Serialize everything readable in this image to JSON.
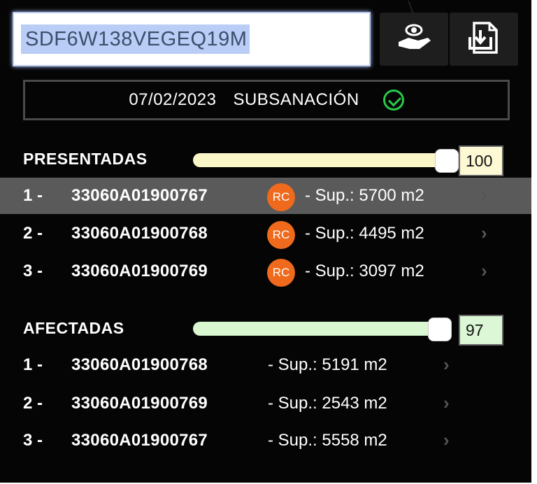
{
  "search": {
    "value": "SDF6W138VEGEQ19M"
  },
  "toolbar": {
    "hand_icon": "hand-pointer-icon",
    "export_icon": "document-download-icon"
  },
  "status": {
    "date": "07/02/2023",
    "label": "SUBSANACIÓN",
    "icon": "check-circle-icon",
    "color": "#28c94a"
  },
  "presentadas": {
    "title": "PRESENTADAS",
    "slider_value": "100",
    "track_color": "#fbf6c8",
    "items": [
      {
        "index": "1 -",
        "code": "33060A01900767",
        "badge": "RC",
        "sup": "- Sup.: 5700 m2"
      },
      {
        "index": "2 -",
        "code": "33060A01900768",
        "badge": "RC",
        "sup": "- Sup.: 4495 m2"
      },
      {
        "index": "3 -",
        "code": "33060A01900769",
        "badge": "RC",
        "sup": "- Sup.: 3097 m2"
      }
    ]
  },
  "afectadas": {
    "title": "AFECTADAS",
    "slider_value": "97",
    "track_color": "#d9f7d0",
    "items": [
      {
        "index": "1 -",
        "code": "33060A01900768",
        "sup": "- Sup.: 5191 m2"
      },
      {
        "index": "2 -",
        "code": "33060A01900769",
        "sup": "- Sup.: 2543 m2"
      },
      {
        "index": "3 -",
        "code": "33060A01900767",
        "sup": "- Sup.: 5558 m2"
      }
    ]
  },
  "arrow_glyph": "›"
}
